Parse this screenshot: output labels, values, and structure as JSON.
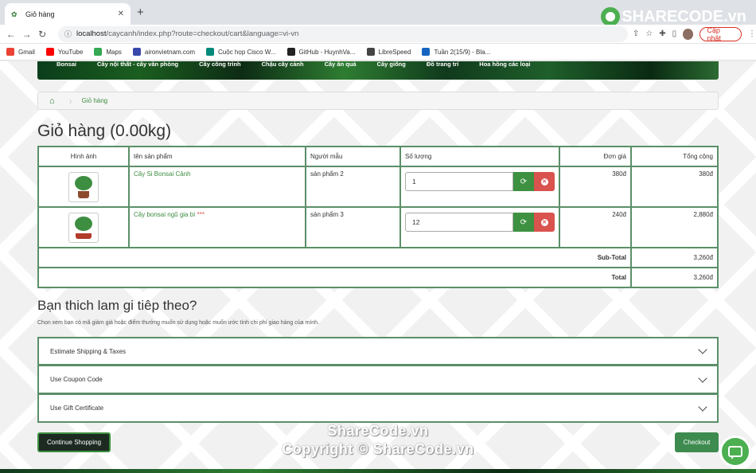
{
  "browser": {
    "tab_title": "Giỏ hàng",
    "url_host": "localhost",
    "url_path": "/caycanh/index.php?route=checkout/cart&language=vi-vn",
    "update_label": "Cập nhật",
    "bookmarks": [
      {
        "label": "Gmail",
        "color": "#ea4335"
      },
      {
        "label": "YouTube",
        "color": "#ff0000"
      },
      {
        "label": "Maps",
        "color": "#34a853"
      },
      {
        "label": "aironvietnam.com",
        "color": "#3949ab"
      },
      {
        "label": "Cuộc họp Cisco W...",
        "color": "#00897b"
      },
      {
        "label": "GitHub - HuynhVa...",
        "color": "#222222"
      },
      {
        "label": "LibreSpeed",
        "color": "#444444"
      },
      {
        "label": "Tuần 2(15/9) - Bla...",
        "color": "#1565c0"
      }
    ],
    "logo": {
      "share": "SHARE",
      "code": "CODE",
      "tld": ".vn"
    }
  },
  "site": {
    "menu": [
      "Bonsai",
      "Cây nội thất - cây văn phòng",
      "Cây công trình",
      "Chậu cây cảnh",
      "Cây ăn quả",
      "Cây giống",
      "Đồ trang trí",
      "Hoa hồng các loại"
    ]
  },
  "breadcrumb": {
    "current": "Giỏ hàng"
  },
  "cart": {
    "title": "Giỏ hàng (0.00kg)",
    "headers": {
      "image": "Hình ảnh",
      "name": "tên sản phẩm",
      "model": "Người mẫu",
      "quantity": "Số lượng",
      "unit_price": "Đơn giá",
      "total": "Tổng cộng"
    },
    "items": [
      {
        "name": "Cây Si Bonsai Cảnh",
        "stars": "",
        "model": "sản phẩm 2",
        "quantity": "1",
        "unit_price": "380đ",
        "total": "380đ"
      },
      {
        "name": "Cây bonsai ngũ gia bì",
        "stars": "***",
        "model": "sản phẩm 3",
        "quantity": "12",
        "unit_price": "240đ",
        "total": "2,880đ"
      }
    ],
    "subtotal_label": "Sub-Total",
    "subtotal_value": "3,260đ",
    "total_label": "Total",
    "total_value": "3,260đ"
  },
  "next": {
    "title": "Bạn thich lam gi tiêp theo?",
    "hint": "Chọn xem bạn có mã giảm giá hoặc điểm thưởng muốn sử dụng hoặc muốn ước tính chi phí giao hàng của mình.",
    "sections": [
      "Estimate Shipping & Taxes",
      "Use Coupon Code",
      "Use Gift Certificate"
    ]
  },
  "buttons": {
    "continue": "Continue Shopping",
    "checkout": "Checkout"
  },
  "watermark": {
    "line1": "ShareCode.vn",
    "line2": "Copyright © ShareCode.vn"
  }
}
